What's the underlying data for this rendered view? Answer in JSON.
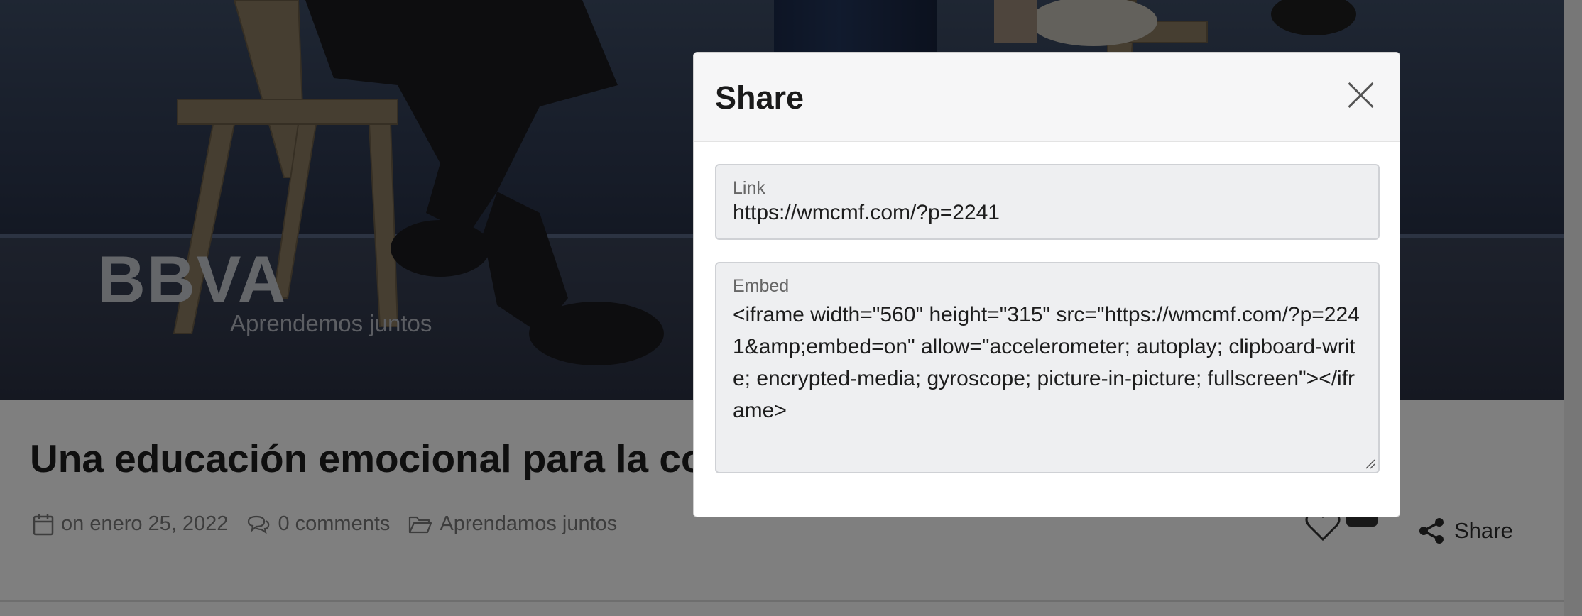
{
  "hero": {
    "logo_text": "BBVA",
    "logo_tagline": "Aprendemos juntos"
  },
  "post": {
    "title": "Una educación emocional para la conviv",
    "date": "on enero 25, 2022",
    "comments": "0 comments",
    "category": "Aprendamos juntos",
    "share_label": "Share"
  },
  "icons": {
    "calendar": "calendar-icon",
    "comments": "comments-icon",
    "folder": "folder-icon",
    "heart": "heart-icon",
    "share": "share-icon",
    "close": "close-icon"
  },
  "modal": {
    "title": "Share",
    "link_label": "Link",
    "link_value": "https://wmcmf.com/?p=2241",
    "embed_label": "Embed",
    "embed_value": "<iframe width=\"560\" height=\"315\" src=\"https://wmcmf.com/?p=2241&amp;embed=on\" allow=\"accelerometer; autoplay; clipboard-write; encrypted-media; gyroscope; picture-in-picture; fullscreen\"></iframe>"
  }
}
